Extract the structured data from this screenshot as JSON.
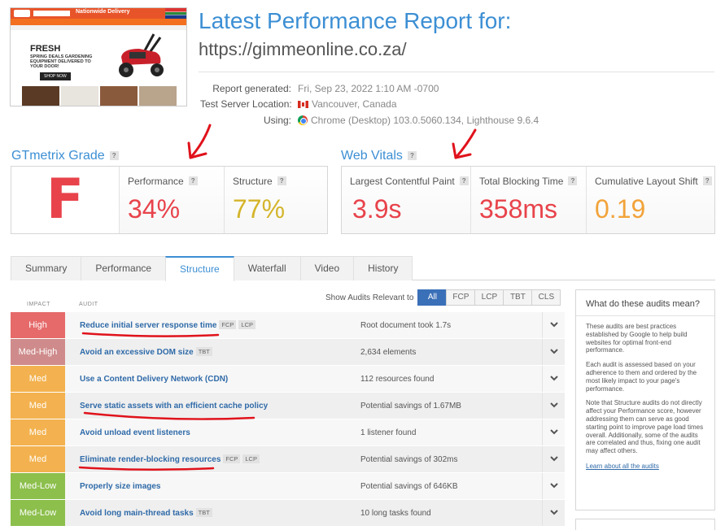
{
  "report": {
    "title": "Latest Performance Report for:",
    "url": "https://gimmeonline.co.za/",
    "meta": [
      {
        "key": "Report generated:",
        "value": "Fri, Sep 23, 2022 1:10 AM -0700",
        "icon": "none"
      },
      {
        "key": "Test Server Location:",
        "value": "Vancouver, Canada",
        "icon": "canada-flag-icon"
      },
      {
        "key": "Using:",
        "value": "Chrome (Desktop) 103.0.5060.134, Lighthouse 9.6.4",
        "icon": "chrome-icon"
      }
    ]
  },
  "screenshot": {
    "banner": "Nationwide Delivery",
    "headline": "FRESH",
    "subline": "SPRING DEALS GARDENING EQUIPMENT DELIVERED TO YOUR DOOR!",
    "cta": "SHOP NOW"
  },
  "grade": {
    "heading": "GTmetrix Grade",
    "help": "?",
    "letter": "F",
    "performance_label": "Performance",
    "performance_value": "34%",
    "structure_label": "Structure",
    "structure_value": "77%"
  },
  "vitals": {
    "heading": "Web Vitals",
    "help": "?",
    "lcp_label": "Largest Contentful Paint",
    "lcp_value": "3.9s",
    "tbt_label": "Total Blocking Time",
    "tbt_value": "358ms",
    "cls_label": "Cumulative Layout Shift",
    "cls_value": "0.19"
  },
  "colors": {
    "accent": "#3c8fd4",
    "bad": "#e8434b",
    "warn": "#d4b52a",
    "cls": "#f2a33a",
    "annotation": "#e0121b"
  },
  "tabs": [
    "Summary",
    "Performance",
    "Structure",
    "Waterfall",
    "Video",
    "History"
  ],
  "active_tab": "Structure",
  "filter": {
    "label": "Show Audits Relevant to",
    "options": [
      "All",
      "FCP",
      "LCP",
      "TBT",
      "CLS"
    ],
    "selected": "All"
  },
  "table": {
    "impact_header": "IMPACT",
    "audit_header": "AUDIT"
  },
  "audits": [
    {
      "impact": "High",
      "title": "Reduce initial server response time",
      "tags": [
        "FCP",
        "LCP"
      ],
      "result": "Root document took 1.7s"
    },
    {
      "impact": "Med-High",
      "title": "Avoid an excessive DOM size",
      "tags": [
        "TBT"
      ],
      "result": "2,634 elements"
    },
    {
      "impact": "Med",
      "title": "Use a Content Delivery Network (CDN)",
      "tags": [],
      "result": "112 resources found"
    },
    {
      "impact": "Med",
      "title": "Serve static assets with an efficient cache policy",
      "tags": [],
      "result": "Potential savings of 1.67MB"
    },
    {
      "impact": "Med",
      "title": "Avoid unload event listeners",
      "tags": [],
      "result": "1 listener found"
    },
    {
      "impact": "Med",
      "title": "Eliminate render-blocking resources",
      "tags": [
        "FCP",
        "LCP"
      ],
      "result": "Potential savings of 302ms"
    },
    {
      "impact": "Med-Low",
      "title": "Properly size images",
      "tags": [],
      "result": "Potential savings of 646KB"
    },
    {
      "impact": "Med-Low",
      "title": "Avoid long main-thread tasks",
      "tags": [
        "TBT"
      ],
      "result": "10 long tasks found"
    }
  ],
  "sidebar": {
    "heading": "What do these audits mean?",
    "p1": "These audits are best practices established by Google to help build websites for optimal front-end performance.",
    "p2": "Each audit is assessed based on your adherence to them and ordered by the most likely impact to your page's performance.",
    "p3": "Note that Structure audits do not directly affect your Performance score, however addressing them can serve as good starting point to improve page load times overall. Additionally, some of the audits are correlated and thus, fixing one audit may affect others.",
    "link": "Learn about all the audits"
  }
}
